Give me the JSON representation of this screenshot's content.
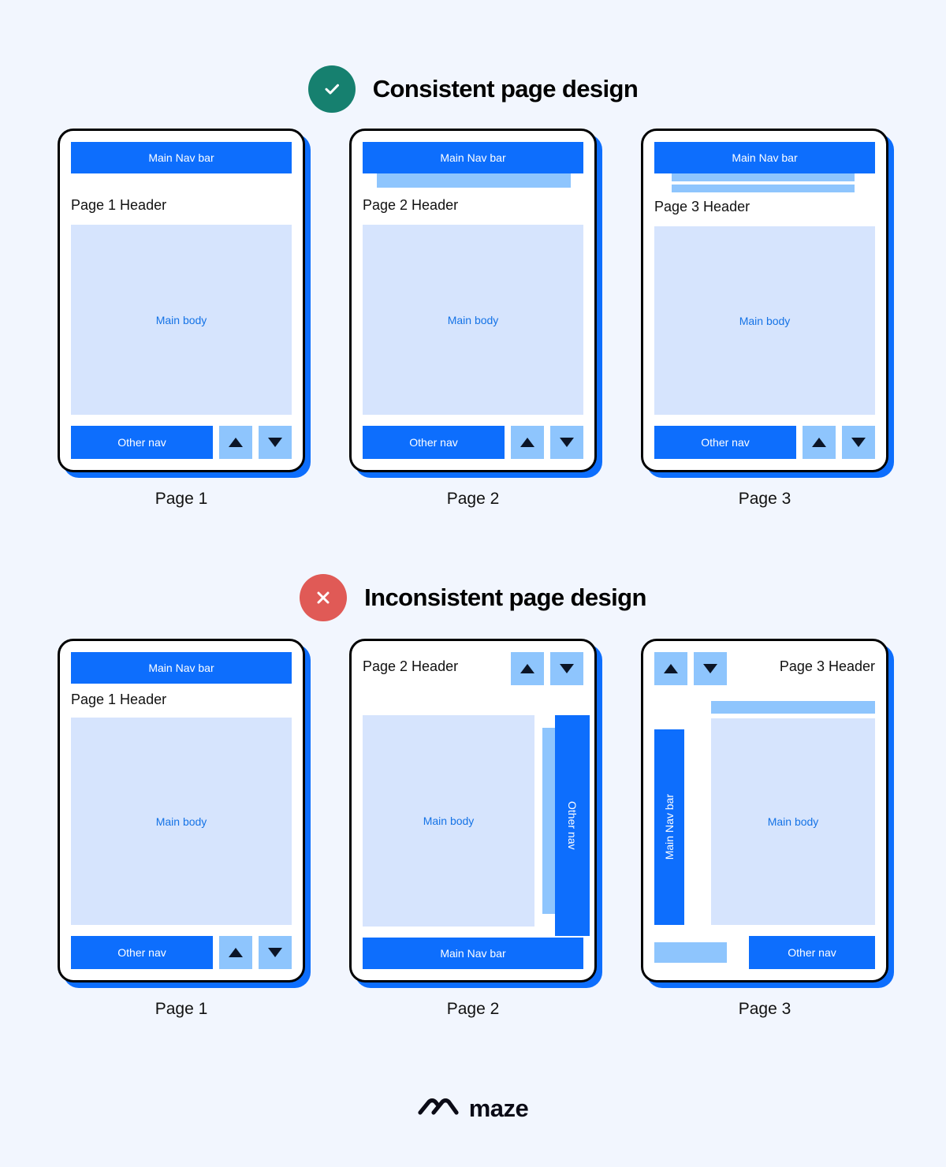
{
  "brand": {
    "name": "maze",
    "logo_icon": "maze-logo-icon"
  },
  "sections": [
    {
      "id": "consistent",
      "badge_icon": "check-circle-icon",
      "badge_color": "#16806f",
      "title": "Consistent page design",
      "cards": [
        {
          "label": "Page 1",
          "nav_label": "Main Nav bar",
          "header": "Page 1 Header",
          "body_label": "Main body",
          "other_nav_label": "Other nav",
          "up_icon": "arrow-up-icon",
          "down_icon": "arrow-down-icon",
          "subbars": 0
        },
        {
          "label": "Page 2",
          "nav_label": "Main Nav bar",
          "header": "Page 2 Header",
          "body_label": "Main body",
          "other_nav_label": "Other nav",
          "up_icon": "arrow-up-icon",
          "down_icon": "arrow-down-icon",
          "subbars": 1
        },
        {
          "label": "Page 3",
          "nav_label": "Main Nav bar",
          "header": "Page 3 Header",
          "body_label": "Main body",
          "other_nav_label": "Other nav",
          "up_icon": "arrow-up-icon",
          "down_icon": "arrow-down-icon",
          "subbars": 2
        }
      ]
    },
    {
      "id": "inconsistent",
      "badge_icon": "x-circle-icon",
      "badge_color": "#e05a56",
      "title": "Inconsistent page design",
      "cards": [
        {
          "label": "Page 1",
          "nav_label": "Main Nav bar",
          "header": "Page 1 Header",
          "body_label": "Main body",
          "other_nav_label": "Other nav",
          "up_icon": "arrow-up-icon",
          "down_icon": "arrow-down-icon"
        },
        {
          "label": "Page 2",
          "nav_label": "Main Nav bar",
          "header": "Page 2 Header",
          "body_label": "Main body",
          "other_nav_label": "Other nav",
          "up_icon": "arrow-up-icon",
          "down_icon": "arrow-down-icon"
        },
        {
          "label": "Page 3",
          "nav_label": "Main Nav bar",
          "header": "Page 3 Header",
          "body_label": "Main body",
          "other_nav_label": "Other nav",
          "up_icon": "arrow-up-icon",
          "down_icon": "arrow-down-icon"
        }
      ]
    }
  ],
  "colors": {
    "page_bg": "#f2f6fe",
    "primary_blue": "#0d6efd",
    "mid_blue": "#8ec5fd",
    "light_blue": "#d6e4fd",
    "ok_green": "#16806f",
    "bad_red": "#e05a56",
    "border_black": "#000000"
  }
}
